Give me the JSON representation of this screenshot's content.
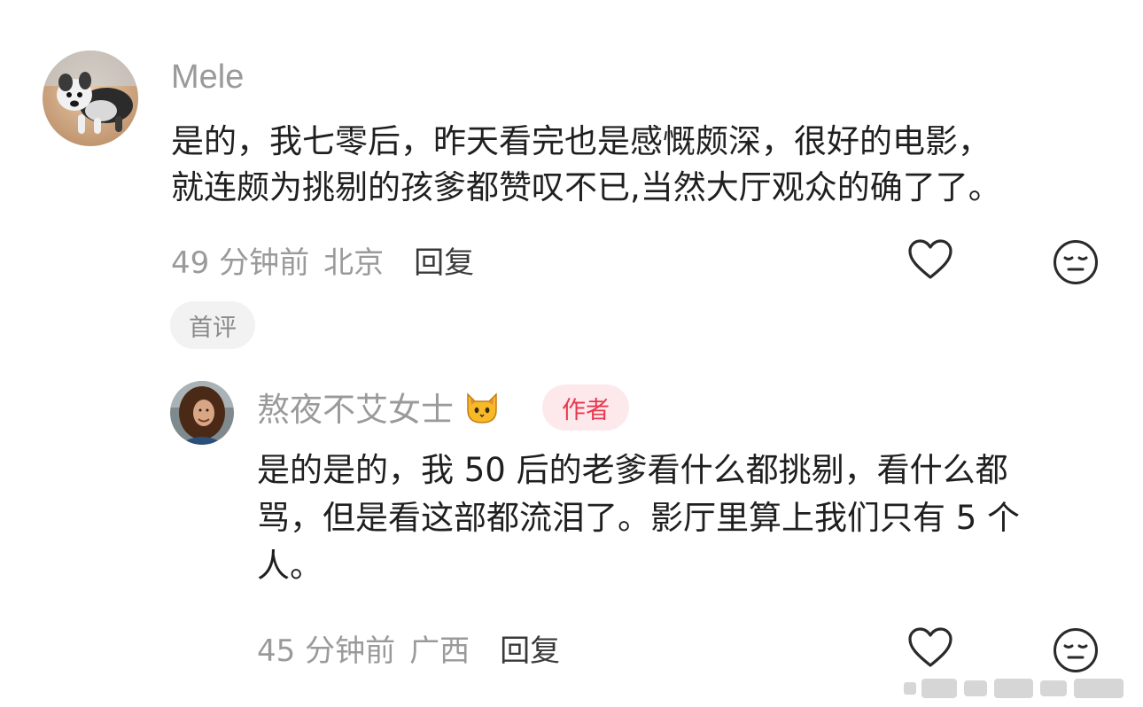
{
  "comments": [
    {
      "username": "Mele",
      "lines": [
        "是的，我七零后，昨天看完也是感慨颇深，很好的电影，",
        "就连颇为挑剔的孩爹都赞叹不已,当然大厅观众的确了了。"
      ],
      "time": "49 分钟前",
      "location": "北京",
      "reply_label": "回复",
      "badge": "首评",
      "avatar_icon": "dog-photo-avatar",
      "like_icon": "heart-outline-icon",
      "dislike_icon": "meh-face-icon"
    },
    {
      "username": "熬夜不艾女士",
      "username_emoji": "🐱",
      "author_tag": "作者",
      "lines": [
        "是的是的，我 50 后的老爹看什么都挑剔，看什么都",
        "骂，但是看这部都流泪了。影厅里算上我们只有 5 个",
        "人。"
      ],
      "time": "45 分钟前",
      "location": "广西",
      "reply_label": "回复",
      "avatar_icon": "woman-photo-avatar",
      "like_icon": "heart-outline-icon",
      "dislike_icon": "meh-face-icon"
    }
  ],
  "colors": {
    "text": "#1f1f1f",
    "meta": "#9a9a9a",
    "author_tag_bg": "#fde9ec",
    "author_tag_text": "#e8384f",
    "badge_bg": "#f2f2f2"
  }
}
